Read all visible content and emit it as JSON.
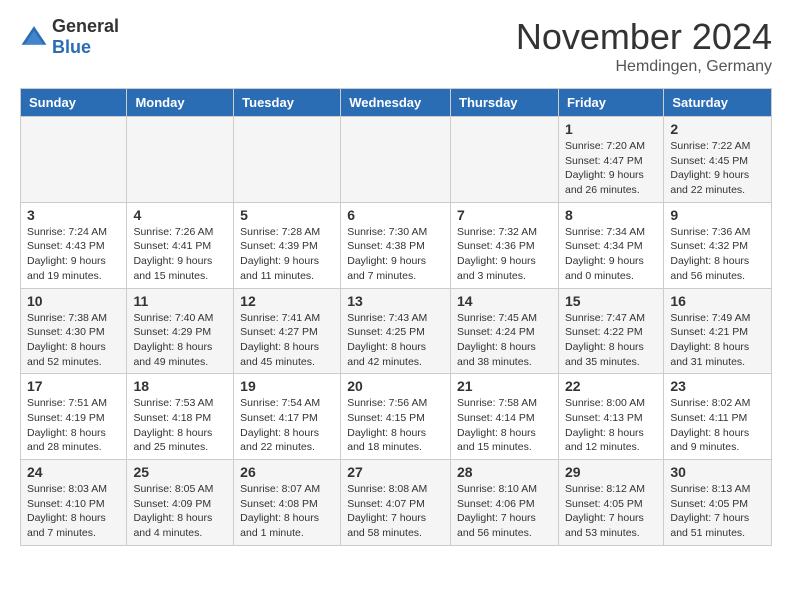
{
  "header": {
    "logo_general": "General",
    "logo_blue": "Blue",
    "title": "November 2024",
    "location": "Hemdingen, Germany"
  },
  "days_of_week": [
    "Sunday",
    "Monday",
    "Tuesday",
    "Wednesday",
    "Thursday",
    "Friday",
    "Saturday"
  ],
  "weeks": [
    [
      {
        "day": "",
        "info": ""
      },
      {
        "day": "",
        "info": ""
      },
      {
        "day": "",
        "info": ""
      },
      {
        "day": "",
        "info": ""
      },
      {
        "day": "",
        "info": ""
      },
      {
        "day": "1",
        "info": "Sunrise: 7:20 AM\nSunset: 4:47 PM\nDaylight: 9 hours and 26 minutes."
      },
      {
        "day": "2",
        "info": "Sunrise: 7:22 AM\nSunset: 4:45 PM\nDaylight: 9 hours and 22 minutes."
      }
    ],
    [
      {
        "day": "3",
        "info": "Sunrise: 7:24 AM\nSunset: 4:43 PM\nDaylight: 9 hours and 19 minutes."
      },
      {
        "day": "4",
        "info": "Sunrise: 7:26 AM\nSunset: 4:41 PM\nDaylight: 9 hours and 15 minutes."
      },
      {
        "day": "5",
        "info": "Sunrise: 7:28 AM\nSunset: 4:39 PM\nDaylight: 9 hours and 11 minutes."
      },
      {
        "day": "6",
        "info": "Sunrise: 7:30 AM\nSunset: 4:38 PM\nDaylight: 9 hours and 7 minutes."
      },
      {
        "day": "7",
        "info": "Sunrise: 7:32 AM\nSunset: 4:36 PM\nDaylight: 9 hours and 3 minutes."
      },
      {
        "day": "8",
        "info": "Sunrise: 7:34 AM\nSunset: 4:34 PM\nDaylight: 9 hours and 0 minutes."
      },
      {
        "day": "9",
        "info": "Sunrise: 7:36 AM\nSunset: 4:32 PM\nDaylight: 8 hours and 56 minutes."
      }
    ],
    [
      {
        "day": "10",
        "info": "Sunrise: 7:38 AM\nSunset: 4:30 PM\nDaylight: 8 hours and 52 minutes."
      },
      {
        "day": "11",
        "info": "Sunrise: 7:40 AM\nSunset: 4:29 PM\nDaylight: 8 hours and 49 minutes."
      },
      {
        "day": "12",
        "info": "Sunrise: 7:41 AM\nSunset: 4:27 PM\nDaylight: 8 hours and 45 minutes."
      },
      {
        "day": "13",
        "info": "Sunrise: 7:43 AM\nSunset: 4:25 PM\nDaylight: 8 hours and 42 minutes."
      },
      {
        "day": "14",
        "info": "Sunrise: 7:45 AM\nSunset: 4:24 PM\nDaylight: 8 hours and 38 minutes."
      },
      {
        "day": "15",
        "info": "Sunrise: 7:47 AM\nSunset: 4:22 PM\nDaylight: 8 hours and 35 minutes."
      },
      {
        "day": "16",
        "info": "Sunrise: 7:49 AM\nSunset: 4:21 PM\nDaylight: 8 hours and 31 minutes."
      }
    ],
    [
      {
        "day": "17",
        "info": "Sunrise: 7:51 AM\nSunset: 4:19 PM\nDaylight: 8 hours and 28 minutes."
      },
      {
        "day": "18",
        "info": "Sunrise: 7:53 AM\nSunset: 4:18 PM\nDaylight: 8 hours and 25 minutes."
      },
      {
        "day": "19",
        "info": "Sunrise: 7:54 AM\nSunset: 4:17 PM\nDaylight: 8 hours and 22 minutes."
      },
      {
        "day": "20",
        "info": "Sunrise: 7:56 AM\nSunset: 4:15 PM\nDaylight: 8 hours and 18 minutes."
      },
      {
        "day": "21",
        "info": "Sunrise: 7:58 AM\nSunset: 4:14 PM\nDaylight: 8 hours and 15 minutes."
      },
      {
        "day": "22",
        "info": "Sunrise: 8:00 AM\nSunset: 4:13 PM\nDaylight: 8 hours and 12 minutes."
      },
      {
        "day": "23",
        "info": "Sunrise: 8:02 AM\nSunset: 4:11 PM\nDaylight: 8 hours and 9 minutes."
      }
    ],
    [
      {
        "day": "24",
        "info": "Sunrise: 8:03 AM\nSunset: 4:10 PM\nDaylight: 8 hours and 7 minutes."
      },
      {
        "day": "25",
        "info": "Sunrise: 8:05 AM\nSunset: 4:09 PM\nDaylight: 8 hours and 4 minutes."
      },
      {
        "day": "26",
        "info": "Sunrise: 8:07 AM\nSunset: 4:08 PM\nDaylight: 8 hours and 1 minute."
      },
      {
        "day": "27",
        "info": "Sunrise: 8:08 AM\nSunset: 4:07 PM\nDaylight: 7 hours and 58 minutes."
      },
      {
        "day": "28",
        "info": "Sunrise: 8:10 AM\nSunset: 4:06 PM\nDaylight: 7 hours and 56 minutes."
      },
      {
        "day": "29",
        "info": "Sunrise: 8:12 AM\nSunset: 4:05 PM\nDaylight: 7 hours and 53 minutes."
      },
      {
        "day": "30",
        "info": "Sunrise: 8:13 AM\nSunset: 4:05 PM\nDaylight: 7 hours and 51 minutes."
      }
    ]
  ]
}
